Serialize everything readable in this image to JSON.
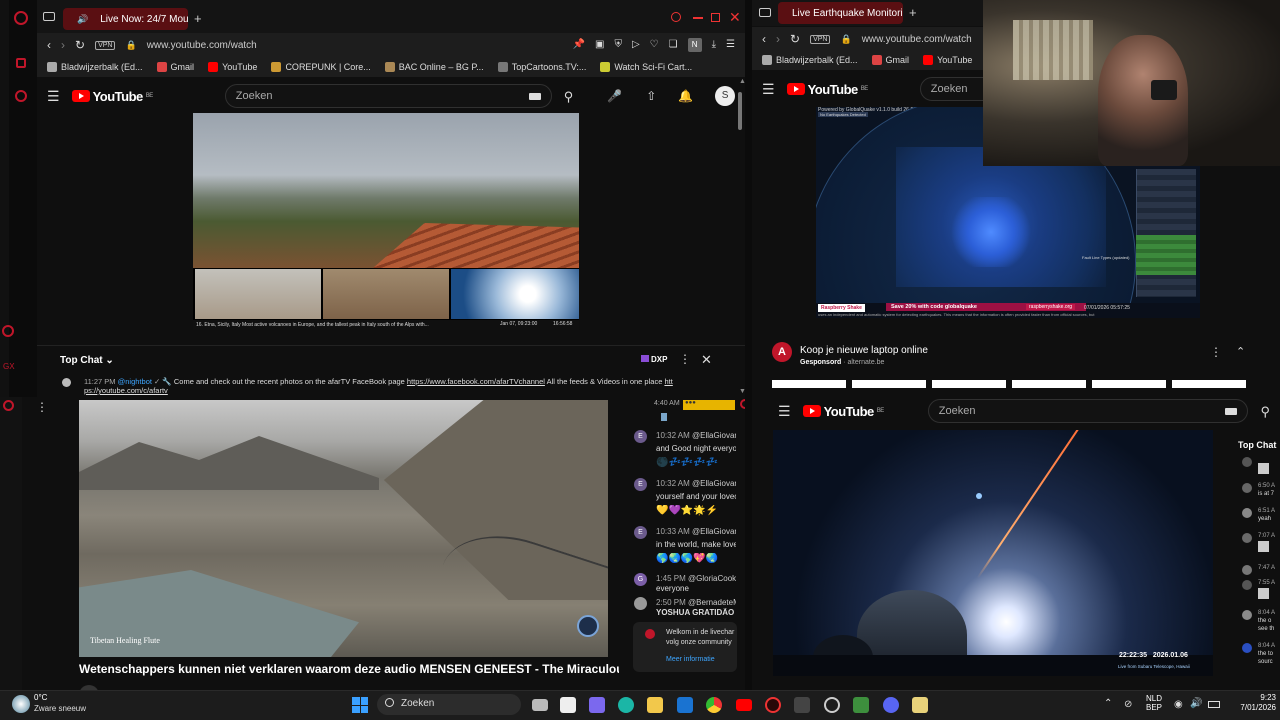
{
  "left_window": {
    "tab_title": "Live Now: 24/7 Mou",
    "url": "www.youtube.com/watch",
    "vpn_label": "VPN",
    "bookmarks": [
      "Bladwijzerbalk (Ed...",
      "Gmail",
      "YouTube",
      "COREPUNK | Core...",
      "BAC Online – BG P...",
      "TopCartoons.TV:...",
      "Watch Sci-Fi Cart..."
    ],
    "search_placeholder": "Zoeken",
    "logo_text": "YouTube",
    "logo_suffix": "BE",
    "avatar_letter": "S",
    "video_caption": "16. Etna, Sicily, Italy   Most active volcanoes in Europe, and the tallest peak in Italy south of the Alps with...",
    "video_time": "Jan 07, 09:23:00",
    "video_clock": "16:56:58",
    "chat_header": "Top Chat",
    "chat_xp": "DXP",
    "pinned_time": "11:27 PM",
    "pinned_user": "@nightbot",
    "pinned_text": "Come and check out the recent photos on the afarTV FaceBook page ",
    "pinned_link1": "https://www.facebook.com/afarTVchannel",
    "pinned_text2": " All the feeds & Videos in one place ",
    "pinned_link2a": "htt",
    "pinned_link2b": "ps://youtube.com/c/afartv"
  },
  "lower_left": {
    "video_title": "Wetenschappers kunnen niet verklaren waarom deze audio MENSEN GENEEST - The Miraculous",
    "watermark": "Tibetan Healing Flute",
    "channel_partial": "Tibetan Healing Flute",
    "chat": [
      {
        "time": "4:40 AM",
        "user": "",
        "text": "",
        "avatar": ""
      },
      {
        "time": "10:32 AM",
        "user": "@EllaGiovanc",
        "text": "and Good night everyo",
        "avatar": "E"
      },
      {
        "time": "10:32 AM",
        "user": "@EllaGiovanc",
        "text": "yourself and your lovec",
        "avatar": "E"
      },
      {
        "time": "10:33 AM",
        "user": "@EllaGiovanc",
        "text": "in the world, make love",
        "avatar": "E"
      },
      {
        "time": "1:45 PM",
        "user": "@GloriaCook-r",
        "text": "everyone",
        "avatar": "G"
      },
      {
        "time": "2:50 PM",
        "user": "@BernadeteM",
        "text": "YOSHUA GRATIDÃO",
        "avatar": ""
      }
    ],
    "welcome_text1": "Welkom in de livechar",
    "welcome_text2": "volg onze community",
    "welcome_link": "Meer informatie"
  },
  "right_window": {
    "tab_title": "Live Earthquake Monitorin",
    "url": "www.youtube.com/watch",
    "vpn_label": "VPN",
    "bookmarks": [
      "Bladwijzerbalk (Ed...",
      "Gmail",
      "YouTube"
    ],
    "search_placeholder": "Zoeken",
    "logo_text": "YouTube",
    "logo_suffix": "BE",
    "map_title": "Powered by GlobalQuake v1.1.0 build 26-5 (d)",
    "map_sub": "No Earthquakes Detected",
    "promo_text": "Save 20% with code",
    "promo_code": "globalquake",
    "promo_brand": "Raspberry Shake",
    "promo_url": "raspberryshake.org",
    "map_footer": "uses an independent and automatic system for detecting earthquakes. This means that the information is often provided faster than from official sources, but",
    "map_date": "07/01/2026 05:57:25",
    "legend_title": "Fault Line Types (updated)",
    "ad_title": "Koop je nieuwe laptop online",
    "ad_sponsored": "Gesponsord",
    "ad_domain": "alternate.be"
  },
  "lower_right": {
    "search_placeholder": "Zoeken",
    "logo_text": "YouTube",
    "logo_suffix": "BE",
    "top_chat": "Top Chat",
    "timestamp": "22:22:35",
    "datestamp": "2026.01.06",
    "telescope": "Live from Subaru Telescope, Hawaii",
    "chat_partial": [
      {
        "time": "6:50 A",
        "text": "is at 7"
      },
      {
        "time": "6:51 A",
        "text": "yeah"
      },
      {
        "time": "7:07 A",
        "text": ""
      },
      {
        "time": "7:47 A",
        "text": ""
      },
      {
        "time": "7:55 A",
        "text": ""
      },
      {
        "time": "8:04 A",
        "text": "the o"
      },
      {
        "time": "",
        "text": "see th"
      },
      {
        "time": "8:04 A",
        "text": "the to"
      },
      {
        "time": "",
        "text": "sourc"
      }
    ]
  },
  "taskbar": {
    "weather_temp": "0°C",
    "weather_desc": "Zware sneeuw",
    "search_label": "Zoeken",
    "lang1": "NLD",
    "lang2": "BEP",
    "time": "9:23",
    "date": "7/01/2026"
  },
  "colors": {
    "accent": "#c0162a",
    "yt_red": "#ff0000",
    "link": "#3ea6ff",
    "background": "#0f0f0f"
  }
}
